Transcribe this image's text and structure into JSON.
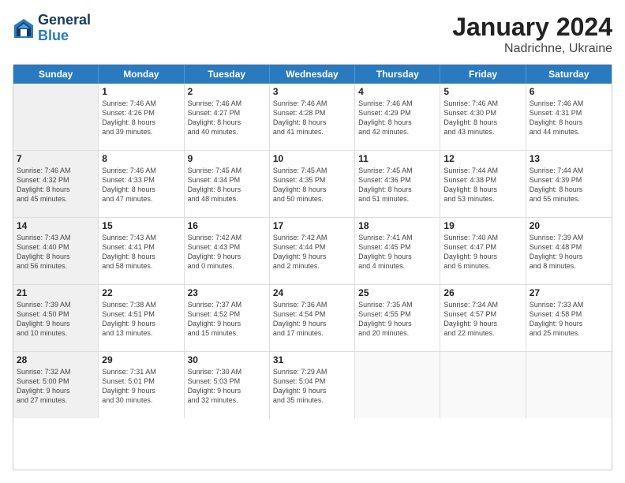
{
  "header": {
    "logo_general": "General",
    "logo_blue": "Blue",
    "title": "January 2024",
    "subtitle": "Nadrichne, Ukraine"
  },
  "days_of_week": [
    "Sunday",
    "Monday",
    "Tuesday",
    "Wednesday",
    "Thursday",
    "Friday",
    "Saturday"
  ],
  "weeks": [
    [
      {
        "day": "",
        "lines": [],
        "shaded": true
      },
      {
        "day": "1",
        "lines": [
          "Sunrise: 7:46 AM",
          "Sunset: 4:26 PM",
          "Daylight: 8 hours",
          "and 39 minutes."
        ]
      },
      {
        "day": "2",
        "lines": [
          "Sunrise: 7:46 AM",
          "Sunset: 4:27 PM",
          "Daylight: 8 hours",
          "and 40 minutes."
        ]
      },
      {
        "day": "3",
        "lines": [
          "Sunrise: 7:46 AM",
          "Sunset: 4:28 PM",
          "Daylight: 8 hours",
          "and 41 minutes."
        ]
      },
      {
        "day": "4",
        "lines": [
          "Sunrise: 7:46 AM",
          "Sunset: 4:29 PM",
          "Daylight: 8 hours",
          "and 42 minutes."
        ]
      },
      {
        "day": "5",
        "lines": [
          "Sunrise: 7:46 AM",
          "Sunset: 4:30 PM",
          "Daylight: 8 hours",
          "and 43 minutes."
        ]
      },
      {
        "day": "6",
        "lines": [
          "Sunrise: 7:46 AM",
          "Sunset: 4:31 PM",
          "Daylight: 8 hours",
          "and 44 minutes."
        ]
      }
    ],
    [
      {
        "day": "7",
        "lines": [
          "Sunrise: 7:46 AM",
          "Sunset: 4:32 PM",
          "Daylight: 8 hours",
          "and 45 minutes."
        ],
        "shaded": true
      },
      {
        "day": "8",
        "lines": [
          "Sunrise: 7:46 AM",
          "Sunset: 4:33 PM",
          "Daylight: 8 hours",
          "and 47 minutes."
        ]
      },
      {
        "day": "9",
        "lines": [
          "Sunrise: 7:45 AM",
          "Sunset: 4:34 PM",
          "Daylight: 8 hours",
          "and 48 minutes."
        ]
      },
      {
        "day": "10",
        "lines": [
          "Sunrise: 7:45 AM",
          "Sunset: 4:35 PM",
          "Daylight: 8 hours",
          "and 50 minutes."
        ]
      },
      {
        "day": "11",
        "lines": [
          "Sunrise: 7:45 AM",
          "Sunset: 4:36 PM",
          "Daylight: 8 hours",
          "and 51 minutes."
        ]
      },
      {
        "day": "12",
        "lines": [
          "Sunrise: 7:44 AM",
          "Sunset: 4:38 PM",
          "Daylight: 8 hours",
          "and 53 minutes."
        ]
      },
      {
        "day": "13",
        "lines": [
          "Sunrise: 7:44 AM",
          "Sunset: 4:39 PM",
          "Daylight: 8 hours",
          "and 55 minutes."
        ]
      }
    ],
    [
      {
        "day": "14",
        "lines": [
          "Sunrise: 7:43 AM",
          "Sunset: 4:40 PM",
          "Daylight: 8 hours",
          "and 56 minutes."
        ],
        "shaded": true
      },
      {
        "day": "15",
        "lines": [
          "Sunrise: 7:43 AM",
          "Sunset: 4:41 PM",
          "Daylight: 8 hours",
          "and 58 minutes."
        ]
      },
      {
        "day": "16",
        "lines": [
          "Sunrise: 7:42 AM",
          "Sunset: 4:43 PM",
          "Daylight: 9 hours",
          "and 0 minutes."
        ]
      },
      {
        "day": "17",
        "lines": [
          "Sunrise: 7:42 AM",
          "Sunset: 4:44 PM",
          "Daylight: 9 hours",
          "and 2 minutes."
        ]
      },
      {
        "day": "18",
        "lines": [
          "Sunrise: 7:41 AM",
          "Sunset: 4:45 PM",
          "Daylight: 9 hours",
          "and 4 minutes."
        ]
      },
      {
        "day": "19",
        "lines": [
          "Sunrise: 7:40 AM",
          "Sunset: 4:47 PM",
          "Daylight: 9 hours",
          "and 6 minutes."
        ]
      },
      {
        "day": "20",
        "lines": [
          "Sunrise: 7:39 AM",
          "Sunset: 4:48 PM",
          "Daylight: 9 hours",
          "and 8 minutes."
        ]
      }
    ],
    [
      {
        "day": "21",
        "lines": [
          "Sunrise: 7:39 AM",
          "Sunset: 4:50 PM",
          "Daylight: 9 hours",
          "and 10 minutes."
        ],
        "shaded": true
      },
      {
        "day": "22",
        "lines": [
          "Sunrise: 7:38 AM",
          "Sunset: 4:51 PM",
          "Daylight: 9 hours",
          "and 13 minutes."
        ]
      },
      {
        "day": "23",
        "lines": [
          "Sunrise: 7:37 AM",
          "Sunset: 4:52 PM",
          "Daylight: 9 hours",
          "and 15 minutes."
        ]
      },
      {
        "day": "24",
        "lines": [
          "Sunrise: 7:36 AM",
          "Sunset: 4:54 PM",
          "Daylight: 9 hours",
          "and 17 minutes."
        ]
      },
      {
        "day": "25",
        "lines": [
          "Sunrise: 7:35 AM",
          "Sunset: 4:55 PM",
          "Daylight: 9 hours",
          "and 20 minutes."
        ]
      },
      {
        "day": "26",
        "lines": [
          "Sunrise: 7:34 AM",
          "Sunset: 4:57 PM",
          "Daylight: 9 hours",
          "and 22 minutes."
        ]
      },
      {
        "day": "27",
        "lines": [
          "Sunrise: 7:33 AM",
          "Sunset: 4:58 PM",
          "Daylight: 9 hours",
          "and 25 minutes."
        ]
      }
    ],
    [
      {
        "day": "28",
        "lines": [
          "Sunrise: 7:32 AM",
          "Sunset: 5:00 PM",
          "Daylight: 9 hours",
          "and 27 minutes."
        ],
        "shaded": true
      },
      {
        "day": "29",
        "lines": [
          "Sunrise: 7:31 AM",
          "Sunset: 5:01 PM",
          "Daylight: 9 hours",
          "and 30 minutes."
        ]
      },
      {
        "day": "30",
        "lines": [
          "Sunrise: 7:30 AM",
          "Sunset: 5:03 PM",
          "Daylight: 9 hours",
          "and 32 minutes."
        ]
      },
      {
        "day": "31",
        "lines": [
          "Sunrise: 7:29 AM",
          "Sunset: 5:04 PM",
          "Daylight: 9 hours",
          "and 35 minutes."
        ]
      },
      {
        "day": "",
        "lines": []
      },
      {
        "day": "",
        "lines": []
      },
      {
        "day": "",
        "lines": []
      }
    ]
  ]
}
